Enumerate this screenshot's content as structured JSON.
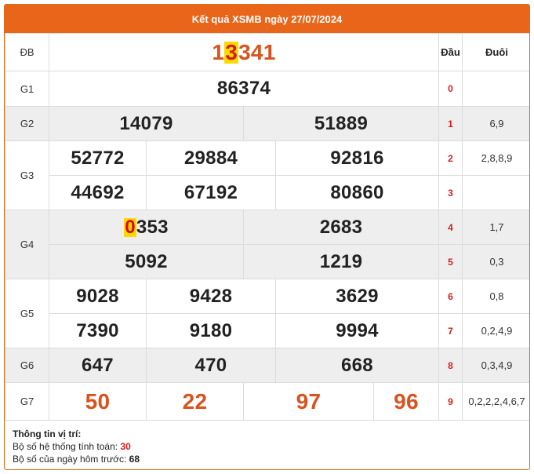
{
  "header": {
    "title": "Kết quả XSMB ngày 27/07/2024"
  },
  "columns": {
    "dau": "Đầu",
    "duoi": "Đuôi"
  },
  "prizes": {
    "db": {
      "label": "ĐB",
      "hl": "3",
      "pre": "1",
      "post": "341"
    },
    "g1": {
      "label": "G1",
      "numbers": [
        "86374"
      ]
    },
    "g2": {
      "label": "G2",
      "numbers": [
        "14079",
        "51889"
      ]
    },
    "g3": {
      "label": "G3",
      "numbers": [
        "52772",
        "29884",
        "92816",
        "44692",
        "67192",
        "80860"
      ]
    },
    "g4": {
      "label": "G4",
      "first": {
        "hl": "0",
        "post": "353"
      },
      "numbers": [
        "2683",
        "5092",
        "1219"
      ]
    },
    "g5": {
      "label": "G5",
      "numbers": [
        "9028",
        "9428",
        "3629",
        "7390",
        "9180",
        "9994"
      ]
    },
    "g6": {
      "label": "G6",
      "numbers": [
        "647",
        "470",
        "668"
      ]
    },
    "g7": {
      "label": "G7",
      "numbers": [
        "50",
        "22",
        "97",
        "96"
      ]
    }
  },
  "loto": [
    {
      "dau": "0",
      "duoi": ""
    },
    {
      "dau": "1",
      "duoi": "6,9"
    },
    {
      "dau": "2",
      "duoi": "2,8,8,9"
    },
    {
      "dau": "3",
      "duoi": ""
    },
    {
      "dau": "4",
      "duoi": "1,7"
    },
    {
      "dau": "5",
      "duoi": "0,3"
    },
    {
      "dau": "6",
      "duoi": "0,8"
    },
    {
      "dau": "7",
      "duoi": "0,2,4,9"
    },
    {
      "dau": "8",
      "duoi": "0,3,4,9"
    },
    {
      "dau": "9",
      "duoi": "0,2,2,2,4,6,7"
    }
  ],
  "info": {
    "title": "Thông tin vị trí:",
    "line1_label": "Bộ số hệ thống tính toán:",
    "line1_value": "30",
    "line2_label": "Bộ số của ngày hôm trước:",
    "line2_value": "68"
  }
}
